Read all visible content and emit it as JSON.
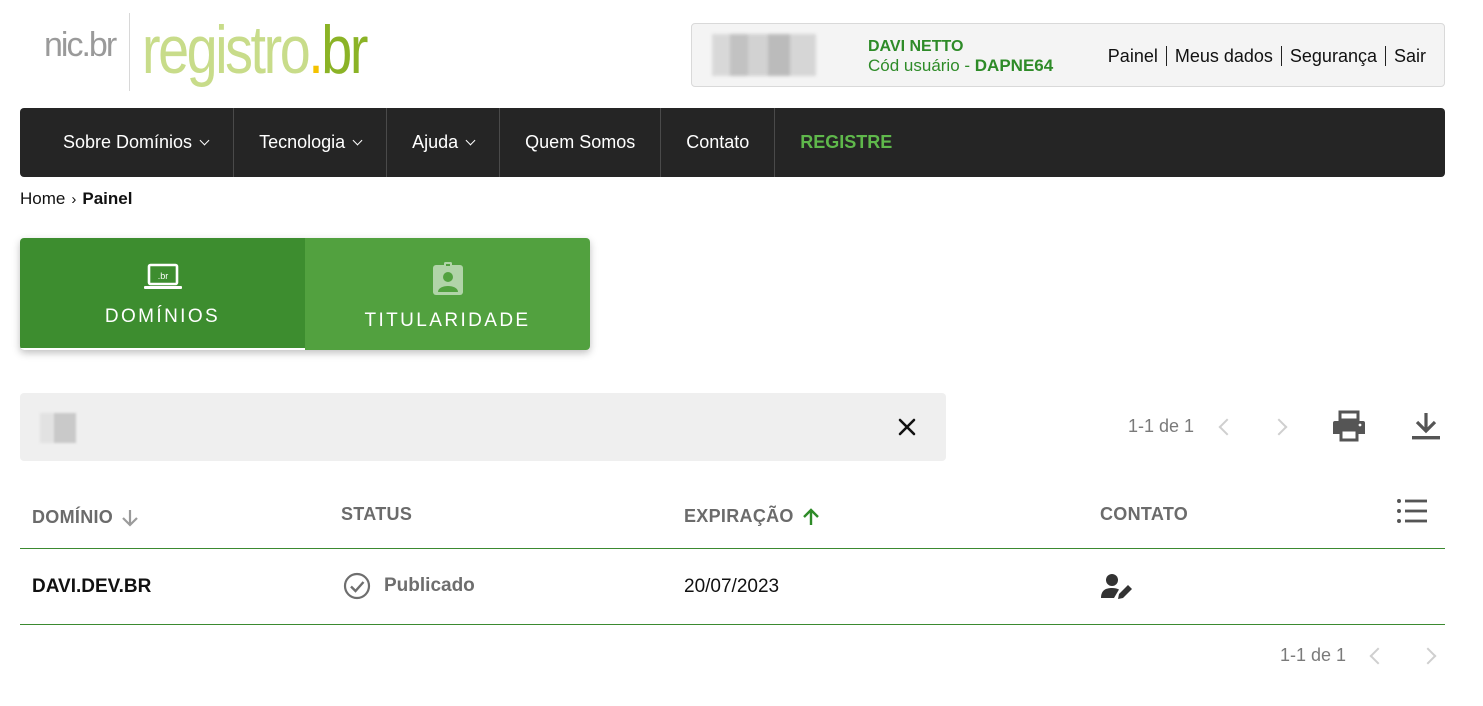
{
  "logo": {
    "nic": "nic.br",
    "registro": "registro",
    "dot": ".",
    "br": "br"
  },
  "user": {
    "name": "DAVI NETTO",
    "code_label": "Cód usuário - ",
    "code": "DAPNE64",
    "links": [
      "Painel",
      "Meus dados",
      "Segurança",
      "Sair"
    ]
  },
  "nav": {
    "items": [
      {
        "label": "Sobre Domínios",
        "dropdown": true
      },
      {
        "label": "Tecnologia",
        "dropdown": true
      },
      {
        "label": "Ajuda",
        "dropdown": true
      },
      {
        "label": "Quem Somos",
        "dropdown": false
      },
      {
        "label": "Contato",
        "dropdown": false
      },
      {
        "label": "REGISTRE",
        "dropdown": false
      }
    ]
  },
  "breadcrumb": {
    "home": "Home",
    "separator": "›",
    "current": "Painel"
  },
  "tabs": [
    {
      "label": "DOMÍNIOS",
      "icon": "laptop-br-icon",
      "active": true
    },
    {
      "label": "TITULARIDADE",
      "icon": "id-badge-icon",
      "active": false
    }
  ],
  "search": {
    "value": "",
    "placeholder": ""
  },
  "pagination": {
    "top": "1-1 de 1",
    "bottom": "1-1 de 1"
  },
  "table": {
    "headers": {
      "domain": "DOMÍNIO",
      "status": "STATUS",
      "expiration": "EXPIRAÇÃO",
      "contact": "CONTATO"
    },
    "rows": [
      {
        "domain": "DAVI.DEV.BR",
        "status": "Publicado",
        "expiration": "20/07/2023",
        "contact_icon": "user-edit-icon"
      }
    ]
  },
  "colors": {
    "green": "#3d8d2f",
    "tab_green": "#52a13f",
    "nav_bg": "#252525",
    "registre": "#5fb84b",
    "text_gray": "#6b6b6b"
  }
}
